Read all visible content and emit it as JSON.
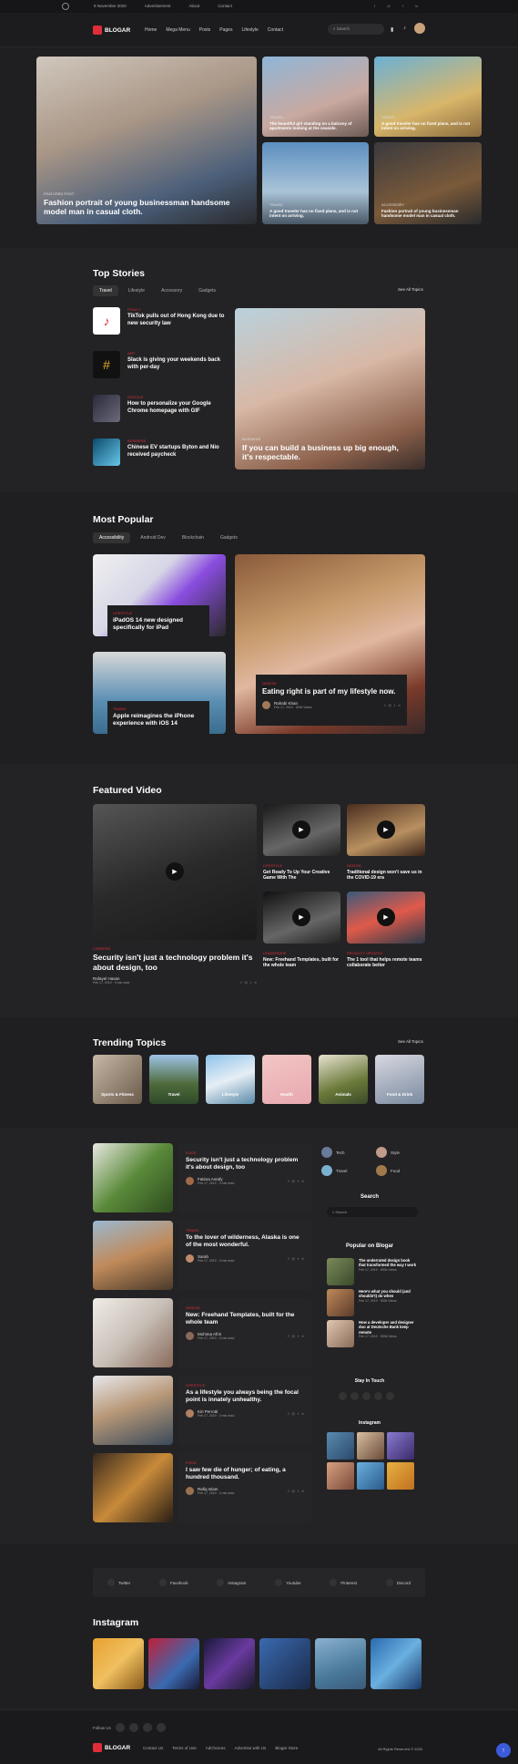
{
  "topbar": {
    "date": "9 November 2020",
    "links": [
      "Advertisement",
      "About",
      "Contact"
    ]
  },
  "nav": {
    "logo": "BLOGAR",
    "menu": [
      "Home",
      "Mega Menu",
      "Posts",
      "Pages",
      "Lifestyle",
      "Contact"
    ],
    "search_placeholder": "Search"
  },
  "hero": {
    "main": {
      "category": "FEATURED POST",
      "title": "Fashion portrait of young businessman handsome model man in casual cloth."
    },
    "side": [
      {
        "category": "TRAVEL",
        "title": "The beautiful girl standing on a balcony of apartments looking at the seaside."
      },
      {
        "category": "TRAVEL",
        "title": "A good traveler has no fixed plans, and is not intent on arriving."
      },
      {
        "category": "TRAVEL",
        "title": "A good traveler has no fixed plans, and is not intent on arriving."
      },
      {
        "category": "ACCESSORY",
        "title": "Fashion portrait of young businessman handsome model man in casual cloth."
      }
    ]
  },
  "top_stories": {
    "title": "Top Stories",
    "tabs": [
      "Travel",
      "Lifestyle",
      "Accessory",
      "Gadgets"
    ],
    "see_all": "See All Topics",
    "items": [
      {
        "category": "POLICY",
        "title": "TikTok pulls out of Hong Kong due to new security law"
      },
      {
        "category": "APP",
        "title": "Slack is giving your weekends back with per-day"
      },
      {
        "category": "GOOGLE",
        "title": "How to personalize your Google Chrome homepage with GIF"
      },
      {
        "category": "BUSINESS",
        "title": "Chinese EV startups Byton and Nio received paycheck"
      }
    ],
    "feature": {
      "category": "BUSINESS",
      "title": "If you can build a business up big enough, it's respectable."
    }
  },
  "most_popular": {
    "title": "Most Popular",
    "tabs": [
      "Accessibility",
      "Android Dev",
      "Blockchain",
      "Gadgets"
    ],
    "a": {
      "category": "LIFESTYLE",
      "title": "iPadOS 14 new designed specifically for iPad"
    },
    "b": {
      "category": "TRAVEL",
      "title": "Apple reimagines the iPhone experience with iOS 14"
    },
    "c": {
      "category": "DESIGN",
      "title": "Eating right is part of my lifestyle now.",
      "author": "Rahabi Khan",
      "date": "Feb 17, 2019 · 300k Views"
    }
  },
  "featured_video": {
    "title": "Featured Video",
    "main": {
      "category": "CAREERS",
      "title": "Security isn't just a technology problem it's about design, too",
      "author": "Rafayel Hasan",
      "date": "Feb 17, 2019 · 3 min read"
    },
    "small": [
      {
        "category": "LIFESTYLE",
        "title": "Get Ready To Up Your Creative Game With The"
      },
      {
        "category": "DESIGN",
        "title": "Traditional design won't save us in the COVID-19 era"
      },
      {
        "category": "LEADERSHIP",
        "title": "New: Freehand Templates, built for the whole team"
      },
      {
        "category": "PRODUCT UPDATES",
        "title": "The 1 tool that helps remote teams collaborate better"
      }
    ]
  },
  "trending": {
    "title": "Trending Topics",
    "see_all": "See All Topics",
    "items": [
      "Sports & Fitness",
      "Travel",
      "Lifestyle",
      "Health",
      "Animals",
      "Food & Drink"
    ]
  },
  "posts": [
    {
      "category": "FOOD",
      "title": "Security isn't just a technology problem it's about design, too",
      "author": "Fatima Asrafy",
      "date": "Feb 17, 2019 · 3 min read"
    },
    {
      "category": "TRAVEL",
      "title": "To the lover of wilderness, Alaska is one of the most wonderful.",
      "author": "Sarah",
      "date": "Feb 17, 2019 · 3 min read"
    },
    {
      "category": "DESIGN",
      "title": "New: Freehand Templates, built for the whole team",
      "author": "Mohima Afrin",
      "date": "Feb 17, 2019 · 3 min read"
    },
    {
      "category": "LIFESTYLE",
      "title": "As a lifestyle you always being the focal point is innately unhealthy.",
      "author": "Kiri Perrotti",
      "date": "Feb 17, 2019 · 3 min read"
    },
    {
      "category": "FOOD",
      "title": "I saw few die of hunger; of eating, a hundred thousand.",
      "author": "Rafiq Islam",
      "date": "Feb 17, 2019 · 3 min read"
    }
  ],
  "sidebar": {
    "cats": [
      "Tech",
      "Style",
      "Travel",
      "Food"
    ],
    "search_title": "Search",
    "search_placeholder": "Search",
    "popular_title": "Popular on Blogar",
    "popular": [
      {
        "title": "The underrated design book that transformed the way I work",
        "date": "Feb 17, 2019 · 300k Views"
      },
      {
        "title": "Here's what you should (and shouldn't) do when",
        "date": "Feb 17, 2019 · 300k Views"
      },
      {
        "title": "How a developer and designer duo at Deutsche Bank keep remote",
        "date": "Feb 17, 2019 · 300k Views"
      }
    ],
    "stay_title": "Stay In Touch",
    "insta_title": "Instagram"
  },
  "social_bar": [
    "Twitter",
    "Facebook",
    "Instagram",
    "Youtube",
    "Pinterest",
    "Discord"
  ],
  "instagram": {
    "title": "Instagram"
  },
  "footer": {
    "follow": "Follow Us",
    "logo": "BLOGAR",
    "links": [
      "Contact Us",
      "Terms of Use",
      "AdChoices",
      "Advertise with Us",
      "Blogar Store"
    ],
    "copyright": "All Rights Reserved © 2020"
  }
}
